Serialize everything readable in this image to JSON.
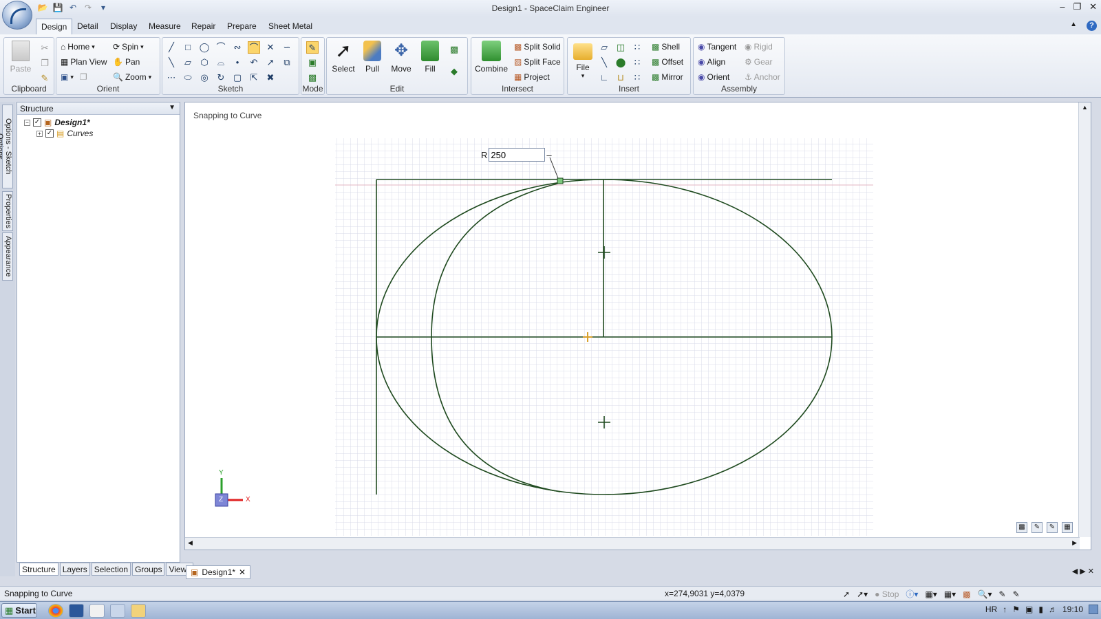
{
  "window": {
    "title": "Design1 - SpaceClaim Engineer"
  },
  "ribbon_tabs": [
    "Design",
    "Detail",
    "Display",
    "Measure",
    "Repair",
    "Prepare",
    "Sheet Metal"
  ],
  "clipboard": {
    "paste": "Paste",
    "label": "Clipboard"
  },
  "orient": {
    "home": "Home",
    "spin": "Spin",
    "plan_view": "Plan View",
    "pan": "Pan",
    "zoom": "Zoom",
    "label": "Orient"
  },
  "sketch": {
    "label": "Sketch"
  },
  "mode": {
    "label": "Mode"
  },
  "edit": {
    "select": "Select",
    "pull": "Pull",
    "move": "Move",
    "fill": "Fill",
    "label": "Edit"
  },
  "intersect": {
    "combine": "Combine",
    "split_solid": "Split Solid",
    "split_face": "Split Face",
    "project": "Project",
    "label": "Intersect"
  },
  "insert": {
    "file": "File",
    "shell": "Shell",
    "offset": "Offset",
    "mirror": "Mirror",
    "label": "Insert"
  },
  "assembly": {
    "tangent": "Tangent",
    "align": "Align",
    "orient": "Orient",
    "rigid": "Rigid",
    "gear": "Gear",
    "anchor": "Anchor",
    "label": "Assembly"
  },
  "side_tabs": [
    "Options - Sketch Options",
    "Properties",
    "Appearance"
  ],
  "structure": {
    "title": "Structure",
    "tree": [
      {
        "label": "Design1*"
      },
      {
        "label": "Curves"
      }
    ],
    "bottom_tabs": [
      "Structure",
      "Layers",
      "Selection",
      "Groups",
      "Views"
    ]
  },
  "viewport": {
    "status": "Snapping to Curve",
    "radius_label": "R",
    "radius_value": "250",
    "axis": {
      "y": "Y",
      "z": "Z",
      "x": "X"
    }
  },
  "doc_tab": {
    "label": "Design1*"
  },
  "statusbar": {
    "left": "Snapping to Curve",
    "coords": "x=274,9031  y=4,0379",
    "stop": "Stop"
  },
  "taskbar": {
    "start": "Start",
    "lang": "HR",
    "time": "19:10"
  }
}
